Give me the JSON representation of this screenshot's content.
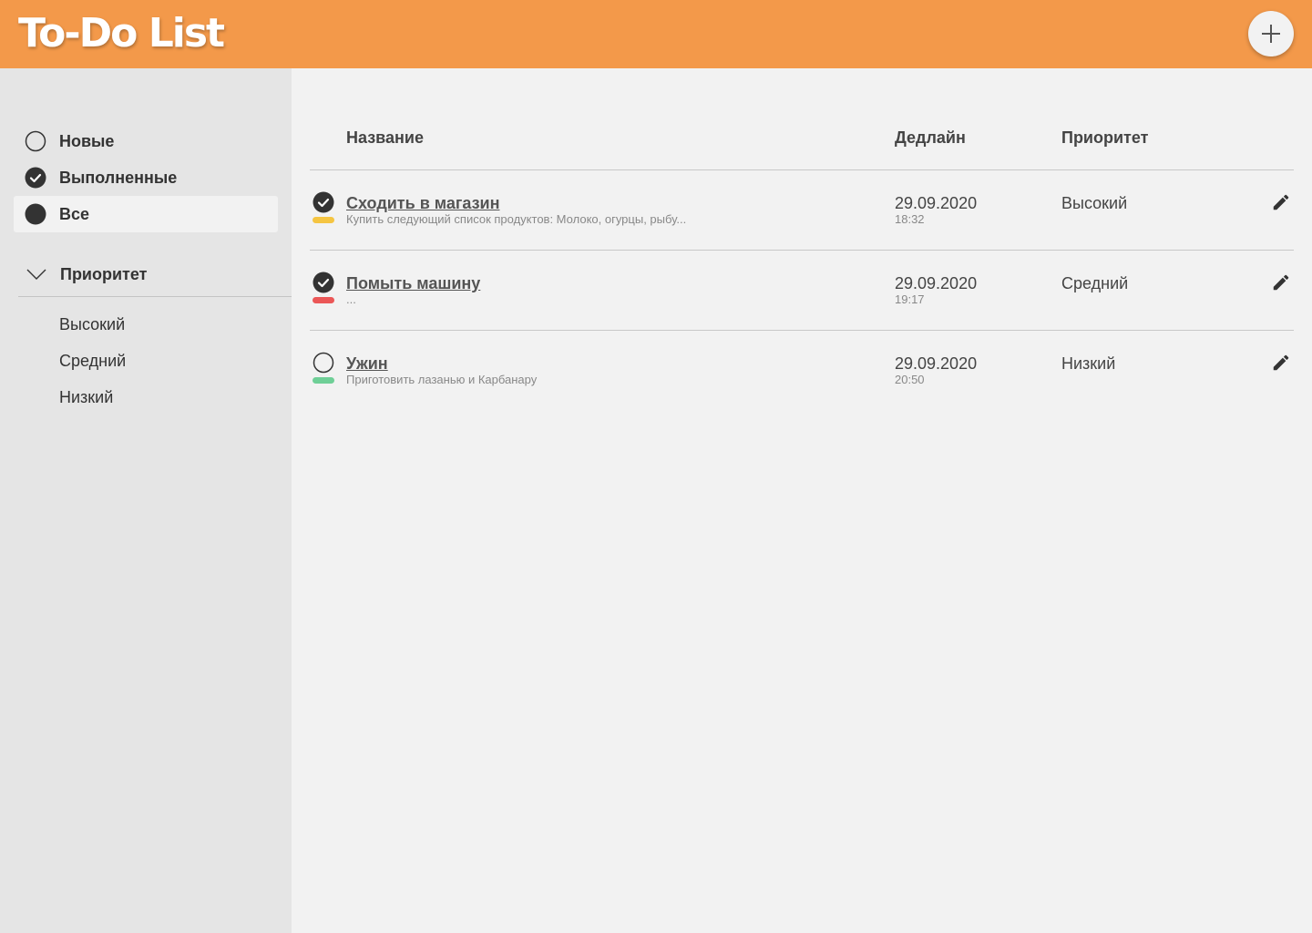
{
  "app": {
    "title": "To-Do List",
    "accent_color": "#f3994a"
  },
  "header": {
    "add_button_icon": "plus-icon"
  },
  "sidebar": {
    "filters": [
      {
        "label": "Новые",
        "icon": "circle-outline-icon",
        "active": false
      },
      {
        "label": "Выполненные",
        "icon": "check-circle-icon",
        "active": false
      },
      {
        "label": "Все",
        "icon": "filled-circle-icon",
        "active": true
      }
    ],
    "priority_section": {
      "title": "Приоритет",
      "expanded": true,
      "items": [
        {
          "label": "Высокий"
        },
        {
          "label": "Средний"
        },
        {
          "label": "Низкий"
        }
      ]
    }
  },
  "table": {
    "columns": {
      "name": "Название",
      "deadline": "Дедлайн",
      "priority": "Приоритет"
    },
    "rows": [
      {
        "title": "Сходить в магазин",
        "description": "Купить следующий список продуктов: Молоко, огурцы, рыбу...",
        "date": "29.09.2020",
        "time": "18:32",
        "priority": "Высокий",
        "done": true,
        "priority_color": "#f5c542"
      },
      {
        "title": "Помыть машину",
        "description": "...",
        "date": "29.09.2020",
        "time": "19:17",
        "priority": "Средний",
        "done": true,
        "priority_color": "#eb5757"
      },
      {
        "title": "Ужин",
        "description": "Приготовить лазанью и Карбанару",
        "date": "29.09.2020",
        "time": "20:50",
        "priority": "Низкий",
        "done": false,
        "priority_color": "#6fcf97"
      }
    ]
  }
}
